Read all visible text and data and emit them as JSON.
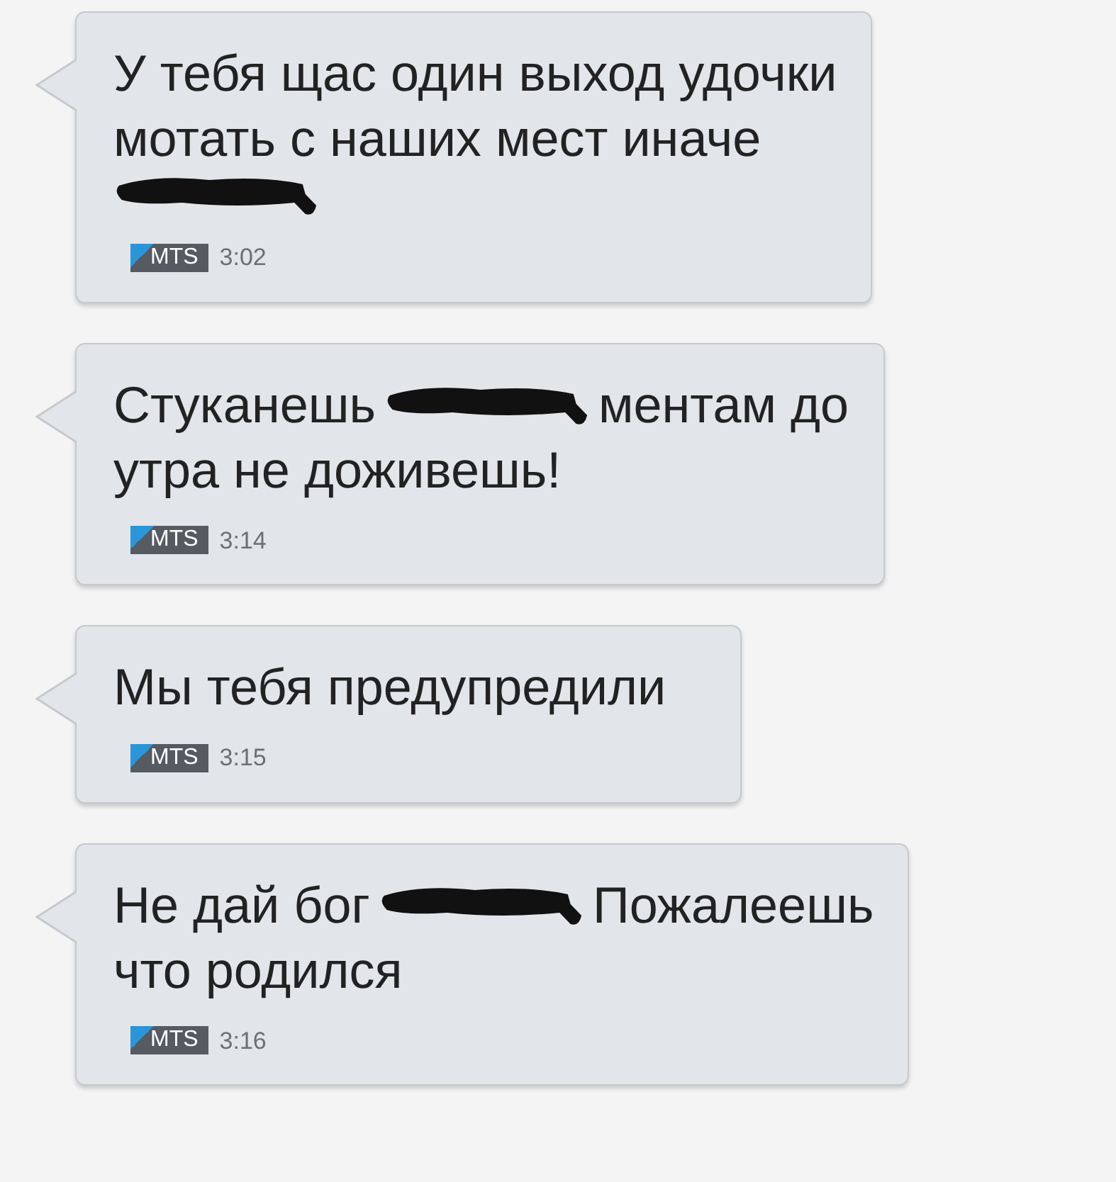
{
  "messages": [
    {
      "lines": [
        [
          {
            "kind": "text",
            "text": "У тебя щас один выход удочки"
          }
        ],
        [
          {
            "kind": "text",
            "text": "мотать с наших мест иначе"
          }
        ],
        [
          {
            "kind": "redaction"
          }
        ]
      ],
      "operator": "MTS",
      "time": "3:02"
    },
    {
      "lines": [
        [
          {
            "kind": "text",
            "text": "Стуканешь"
          },
          {
            "kind": "redaction"
          },
          {
            "kind": "text",
            "text": "ментам до"
          }
        ],
        [
          {
            "kind": "text",
            "text": "утра не доживешь!"
          }
        ]
      ],
      "operator": "MTS",
      "time": "3:14"
    },
    {
      "lines": [
        [
          {
            "kind": "text",
            "text": "Мы тебя предупредили"
          }
        ]
      ],
      "operator": "MTS",
      "time": "3:15"
    },
    {
      "lines": [
        [
          {
            "kind": "text",
            "text": "Не дай бог"
          },
          {
            "kind": "redaction"
          },
          {
            "kind": "text",
            "text": "Пожалеешь"
          }
        ],
        [
          {
            "kind": "text",
            "text": "что родился"
          }
        ]
      ],
      "operator": "MTS",
      "time": "3:16"
    }
  ]
}
